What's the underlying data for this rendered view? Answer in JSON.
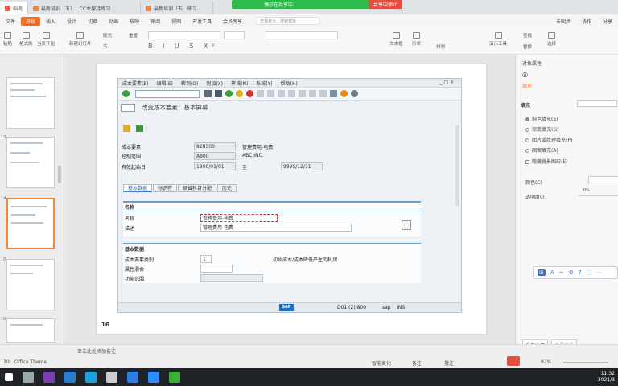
{
  "tabs": [
    {
      "label": "稻壳",
      "color": "#e55b45"
    },
    {
      "label": "最新培训（五）...CC本保持练习",
      "color": "#f0883c"
    },
    {
      "label": "最新培训（五...练习",
      "color": "#f0883c"
    }
  ],
  "share": {
    "status": "偶尔在共享中",
    "stop": "共享中停止"
  },
  "menu": [
    "文件",
    "开始",
    "插入",
    "设计",
    "切换",
    "动画",
    "放映",
    "审阅",
    "视图",
    "开发工具",
    "会员专享"
  ],
  "search_placeholder": "查找命令、搜索模板",
  "top_right": [
    "未同步",
    "协作",
    "分享"
  ],
  "ribbon": {
    "items": [
      "粘贴",
      "格式刷",
      "当页开始",
      "新建幻灯片",
      "版式",
      "节",
      "重置",
      "文本框",
      "形状",
      "排列",
      "演示工具",
      "查找",
      "替换",
      "选择"
    ]
  },
  "thumb_numbers": [
    "",
    "13",
    "14",
    "15",
    "16"
  ],
  "sap": {
    "menu": [
      "成本要素(E)",
      "编辑(E)",
      "转到(G)",
      "附加(X)",
      "环境(N)",
      "系统(Y)",
      "帮助(H)"
    ],
    "window_controls": "_ □ ✕",
    "title": "改变成本要素：基本屏幕",
    "fields": {
      "cost_element": {
        "label": "成本要素",
        "value": "828300",
        "desc": "管理费用-电费"
      },
      "controlling_area": {
        "label": "控制范围",
        "value": "A800",
        "desc": "ABC INC."
      },
      "valid_from": {
        "label": "有效起始日",
        "value": "1900/01/01",
        "to_label": "至",
        "to_value": "9999/12/31"
      }
    },
    "tabs": [
      "基本数据",
      "标识符",
      "缺省科目分配",
      "历史"
    ],
    "group_names": {
      "title": "名称",
      "name_label": "名称",
      "name_value": "管理费用-电费",
      "desc_label": "描述",
      "desc_value": "管理费用-电费"
    },
    "group_basic": {
      "title": "基本数据",
      "category_label": "成本要素类别",
      "category_value": "1",
      "category_desc": "初始成本/成本降低产生的利润",
      "attr_label": "属性混合",
      "func_label": "功能范围"
    },
    "status": {
      "logo": "SAP",
      "system": "D01 (2) 800",
      "user": "sap",
      "mode": "INS"
    }
  },
  "slide_number": "16",
  "right_pane": {
    "title": "对象属性",
    "section": "填充",
    "fill_title": "填充",
    "options": [
      {
        "label": "纯色填充(S)",
        "checked": true
      },
      {
        "label": "渐变填充(G)",
        "checked": false
      },
      {
        "label": "图片或纹理填充(P)",
        "checked": false
      },
      {
        "label": "图案填充(A)",
        "checked": false
      }
    ],
    "hide_bg": "隐藏背景图形(E)",
    "color_label": "颜色(C)",
    "transparency_label": "透明度(T)",
    "transparency_value": "0%",
    "apply_all": "全部应用",
    "reset_bg": "重置背景"
  },
  "status": {
    "page": "30",
    "theme": "Office Theme",
    "notes_hint": "单击此处添加备注",
    "smart": "智能美化",
    "notes": "备注",
    "comment": "批注",
    "zoom": "82%"
  },
  "clock": {
    "time": "11:32",
    "date": "2021/3"
  }
}
